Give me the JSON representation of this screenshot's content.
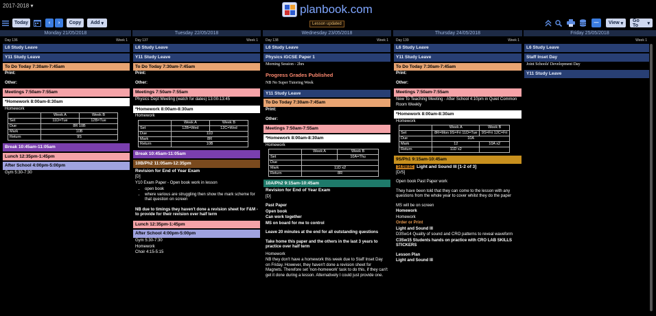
{
  "header": {
    "year": "2017-2018",
    "logo_text": "planbook.com",
    "status": "Lesson updated",
    "today_label": "Today",
    "copy_label": "Copy",
    "add_label": "Add",
    "view_label": "View",
    "goto_label": "Go To"
  },
  "days": [
    {
      "header": "Monday 21/05/2018",
      "day_num": "Day 136",
      "week": "Week 1"
    },
    {
      "header": "Tuesday 22/05/2018",
      "day_num": "Day 137",
      "week": "Week 1"
    },
    {
      "header": "Wednesday 23/05/2018",
      "day_num": "Day 138",
      "week": "Week 1"
    },
    {
      "header": "Thursday 24/05/2018",
      "day_num": "Day 139",
      "week": "Week 1"
    },
    {
      "header": "Friday 25/05/2018",
      "day_num": "",
      "week": "Week 1"
    }
  ],
  "common": {
    "l6_study_leave": "L6 Study Leave",
    "y11_study_leave": "Y11 Study Leave",
    "to_do_today": "To Do Today 7:30am-7:45am",
    "print": "Print:",
    "other": "Other:",
    "meetings": "Meetings 7:50am-7:55am",
    "homework_slot": "*Homework 8:00am-8:30am",
    "homework": "Homework",
    "week_a": "Week A",
    "week_b": "Week B",
    "set": "Set",
    "due": "Due",
    "mark": "Mark",
    "return": "Return",
    "lunch": "Lunch 12:35pm-1:45pm",
    "after_school": "After School 4:00pm-5:00pm",
    "revision_title": "Revision for End of Year Exam"
  },
  "monday": {
    "hw_set_a": "11D=Tue",
    "hw_set_b": "12B=Tue",
    "hw_due": "8R 10B",
    "hw_mark": "10B",
    "hw_return": "9S",
    "break": "Break 10:45am-11:05am",
    "gym": "Gym 5:30-7:30"
  },
  "tuesday": {
    "meeting_note": "Physics Dept Meeting (watch for dates) 13:00-13:45",
    "hw_set_a": "12B=Wed",
    "hw_set_b": "12C=Wed",
    "hw_due": "11D",
    "hw_mark": "8R",
    "hw_return": "10B",
    "break": "Break 10:45am-11:05am",
    "lesson_header": "10B/Ph2 11:05am-12:35pm",
    "d": "[D]",
    "exam_line": "Y10 Exam Paper - Open book work in lesson",
    "bullet1": "open book",
    "bullet2": "where various are struggling then show the mark scheme for that question on screen",
    "nb": "NB due to timings they haven't done a revision sheet for F&M - to provide for their revision over half term",
    "gym": "Gym 5:30-7:30",
    "choir": "Choir 4:15-5:15"
  },
  "wednesday": {
    "physics_paper": "Physics iGCSE Paper 1",
    "morning_session": "Morning Session - 2hrs",
    "progress_grades": "Progress Grades Published",
    "nb_tutoring": "NB No Super Tutoring Week",
    "hw_set_a": "10A=Thu",
    "hw_mark": "11D x2",
    "hw_return": "8R",
    "lesson_header": "10A/Ph2 9:15am-10:45am",
    "d": "[D]",
    "past_paper": "Past Paper",
    "open_book": "Open book",
    "can_work": "Can work together",
    "ms_board": "MS on board for me to control",
    "leave_20": "Leave 20 minutes at the end for all outstanding questions",
    "take_home": "Take home this paper and the others in the last 3 years to practice over half term",
    "nb_homework": "NB they don't have a homework this week due to Staff Inset Day on Friday. However, they haven't done a revision sheet for Magnets. Therefore set 'non-homework' task to do this, if they can't get it done during a lesson. Alternatively I could just provide one."
  },
  "thursday": {
    "meeting_note": "New To Teaching Meeting - After School 4:10pm in Quiet Common Room Weekly",
    "hw_set_a": "8R=Mon 9S=Fri 11D=Tue",
    "hw_set_b": "9S=Fri 12C=Fri",
    "hw_due": "10A",
    "hw_mark_a": "12",
    "hw_mark_b": "10A x2",
    "hw_return": "11D x2",
    "lesson_header": "9S/Ph1 9:15am-10:45am",
    "tag": "14.SW.SC",
    "unit_title": "Light and Sound III [1-2 of 3]",
    "ds": "[D/S]",
    "open_book_past": "Open book Past Paper work",
    "told": "They have been told that they can come to the lesson with any questions from the whole year to cover whilst they do the paper",
    "ms_screen": "MS will be on screen",
    "homework_label": "Homework",
    "homework_val": "Homework",
    "order_print": "Order or Print",
    "light_sound": "Light and Sound III",
    "d3sw14": "D3Sw14 Quality of sound and CRO patterns to reveal waveform",
    "c3sw15": "C3Sw15 Students hands on practice with CRO LAB SKILLS STICKERS",
    "lesson_plan": "Lesson Plan",
    "light_sound2": "Light and Sound III"
  },
  "friday": {
    "staff_inset": "Staff Inset Day",
    "joint_dev": "Joint Schools' Development Day"
  }
}
